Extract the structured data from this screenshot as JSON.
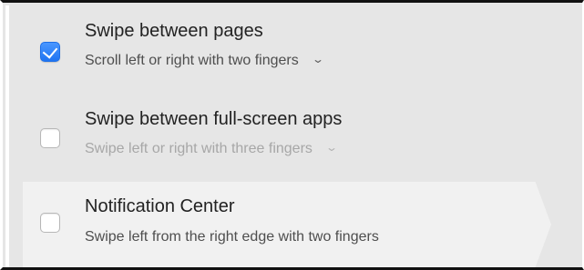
{
  "options": [
    {
      "title": "Swipe between pages",
      "subtitle": "Scroll left or right with two fingers",
      "checked": true,
      "has_dropdown": true
    },
    {
      "title": "Swipe between full-screen apps",
      "subtitle": "Swipe left or right with three fingers",
      "checked": false,
      "has_dropdown": true
    },
    {
      "title": "Notification Center",
      "subtitle": "Swipe left from the right edge with two fingers",
      "checked": false,
      "has_dropdown": false
    }
  ],
  "icons": {
    "checkbox_check": "checkmark-icon",
    "dropdown": "chevron-down-icon"
  },
  "colors": {
    "panel_background": "#e6e6e6",
    "selected_row_background": "#f1f1f1",
    "checkbox_accent": "#1f74f2"
  }
}
